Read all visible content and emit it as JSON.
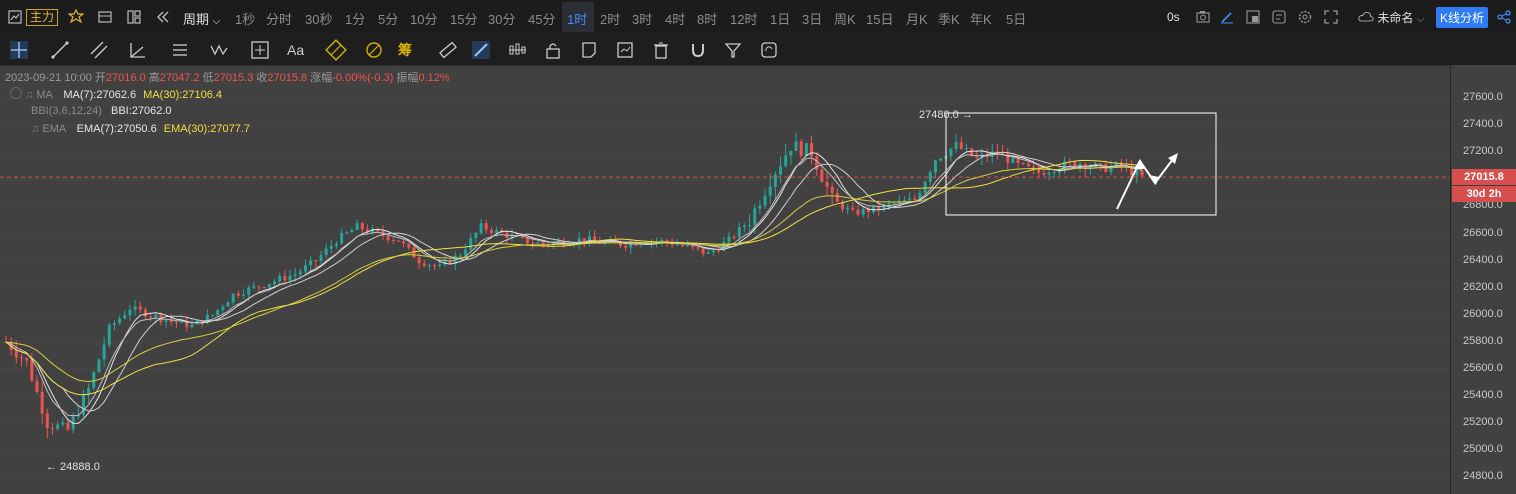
{
  "topbar": {
    "indicator_label": "主力",
    "period_label": "周期",
    "intervals": [
      {
        "label": "1秒",
        "active": false
      },
      {
        "label": "分时",
        "active": false
      },
      {
        "label": "30秒",
        "active": false
      },
      {
        "label": "1分",
        "active": false
      },
      {
        "label": "5分",
        "active": false
      },
      {
        "label": "10分",
        "active": false
      },
      {
        "label": "15分",
        "active": false
      },
      {
        "label": "30分",
        "active": false
      },
      {
        "label": "45分",
        "active": false
      },
      {
        "label": "1时",
        "active": true
      },
      {
        "label": "2时",
        "active": false
      },
      {
        "label": "3时",
        "active": false
      },
      {
        "label": "4时",
        "active": false
      },
      {
        "label": "8时",
        "active": false
      },
      {
        "label": "12时",
        "active": false
      },
      {
        "label": "1日",
        "active": false
      },
      {
        "label": "3日",
        "active": false
      },
      {
        "label": "周K",
        "active": false
      },
      {
        "label": "15日",
        "active": false
      },
      {
        "label": "月K",
        "active": false
      },
      {
        "label": "季K",
        "active": false
      },
      {
        "label": "年K",
        "active": false
      },
      {
        "label": "5日",
        "active": false
      }
    ],
    "latency": "0s",
    "layout_name": "未命名",
    "analysis_button": "K线分析"
  },
  "toolbar": {
    "text_tool_label": "Aa",
    "chip_tool_label": "筹",
    "tools": [
      "crosshair-icon",
      "trendline-icon",
      "parallel-channel-icon",
      "angle-icon",
      "horizontal-lines-icon",
      "wave-icon",
      "measure-icon",
      "text-icon",
      "fib-icon",
      "gann-icon",
      "chips-icon",
      "ruler-icon",
      "brush-icon",
      "candles-icon",
      "lock-icon",
      "note-icon",
      "report-icon",
      "trash-icon",
      "magnet-icon",
      "filter-icon",
      "sync-icon"
    ]
  },
  "info": {
    "datetime": "2023-09-21 10:00",
    "open_label": "开",
    "open": "27016.0",
    "high_label": "高",
    "high": "27047.2",
    "low_label": "低",
    "low": "27015.3",
    "close_label": "收",
    "close": "27015.8",
    "change_label": "涨幅",
    "change": "-0.00%(-0.3)",
    "amp_label": "振幅",
    "amp": "0.12%",
    "ma_name": "MA",
    "ma7": "MA(7):27062.6",
    "ma30": "MA(30):27106.4",
    "bbi_name": "BBI(3,6,12,24)",
    "bbi": "BBI:27062.0",
    "ema_name": "EMA",
    "ema7": "EMA(7):27050.6",
    "ema30": "EMA(30):27077.7"
  },
  "annotations": {
    "high_marker": "27480.0 →",
    "low_marker": "← 24888.0"
  },
  "price_badge": "27015.8",
  "countdown_badge": "30d 2h",
  "colors": {
    "up": "#26a69a",
    "down": "#ef5350",
    "accent": "#3d8cff",
    "ma_white": "#e6e6e6",
    "ma_yellow": "#f0e040",
    "price_line": "#e05050"
  },
  "chart_data": {
    "type": "candlestick",
    "interval": "1时",
    "ylim": [
      24800,
      27650
    ],
    "yticks": [
      27600,
      27400,
      27200,
      27000,
      26800,
      26600,
      26400,
      26200,
      26000,
      25800,
      25600,
      25400,
      25200,
      25000,
      24800
    ],
    "current_price": 27015.8,
    "marked_high": 27480.0,
    "marked_low": 24888.0,
    "series_keypoints": [
      {
        "i": 0,
        "p": 25800
      },
      {
        "i": 4,
        "p": 25650
      },
      {
        "i": 8,
        "p": 25200
      },
      {
        "i": 12,
        "p": 25150
      },
      {
        "i": 16,
        "p": 25450
      },
      {
        "i": 20,
        "p": 25900
      },
      {
        "i": 24,
        "p": 26050
      },
      {
        "i": 28,
        "p": 26000
      },
      {
        "i": 32,
        "p": 25950
      },
      {
        "i": 36,
        "p": 25920
      },
      {
        "i": 40,
        "p": 26000
      },
      {
        "i": 44,
        "p": 26150
      },
      {
        "i": 48,
        "p": 26200
      },
      {
        "i": 52,
        "p": 26250
      },
      {
        "i": 56,
        "p": 26300
      },
      {
        "i": 60,
        "p": 26400
      },
      {
        "i": 64,
        "p": 26550
      },
      {
        "i": 68,
        "p": 26650
      },
      {
        "i": 72,
        "p": 26600
      },
      {
        "i": 76,
        "p": 26550
      },
      {
        "i": 80,
        "p": 26400
      },
      {
        "i": 84,
        "p": 26350
      },
      {
        "i": 88,
        "p": 26450
      },
      {
        "i": 92,
        "p": 26650
      },
      {
        "i": 96,
        "p": 26600
      },
      {
        "i": 100,
        "p": 26550
      },
      {
        "i": 104,
        "p": 26520
      },
      {
        "i": 108,
        "p": 26540
      },
      {
        "i": 112,
        "p": 26560
      },
      {
        "i": 116,
        "p": 26530
      },
      {
        "i": 120,
        "p": 26520
      },
      {
        "i": 124,
        "p": 26550
      },
      {
        "i": 128,
        "p": 26540
      },
      {
        "i": 132,
        "p": 26500
      },
      {
        "i": 136,
        "p": 26450
      },
      {
        "i": 140,
        "p": 26550
      },
      {
        "i": 144,
        "p": 26700
      },
      {
        "i": 148,
        "p": 27000
      },
      {
        "i": 152,
        "p": 27250
      },
      {
        "i": 156,
        "p": 27200
      },
      {
        "i": 160,
        "p": 26850
      },
      {
        "i": 164,
        "p": 26750
      },
      {
        "i": 168,
        "p": 26780
      },
      {
        "i": 172,
        "p": 26820
      },
      {
        "i": 176,
        "p": 26850
      },
      {
        "i": 180,
        "p": 27150
      },
      {
        "i": 184,
        "p": 27250
      },
      {
        "i": 188,
        "p": 27150
      },
      {
        "i": 192,
        "p": 27200
      },
      {
        "i": 196,
        "p": 27100
      },
      {
        "i": 200,
        "p": 27050
      },
      {
        "i": 204,
        "p": 27100
      },
      {
        "i": 208,
        "p": 27120
      },
      {
        "i": 212,
        "p": 27080
      },
      {
        "i": 216,
        "p": 27100
      },
      {
        "i": 220,
        "p": 27015
      }
    ]
  }
}
